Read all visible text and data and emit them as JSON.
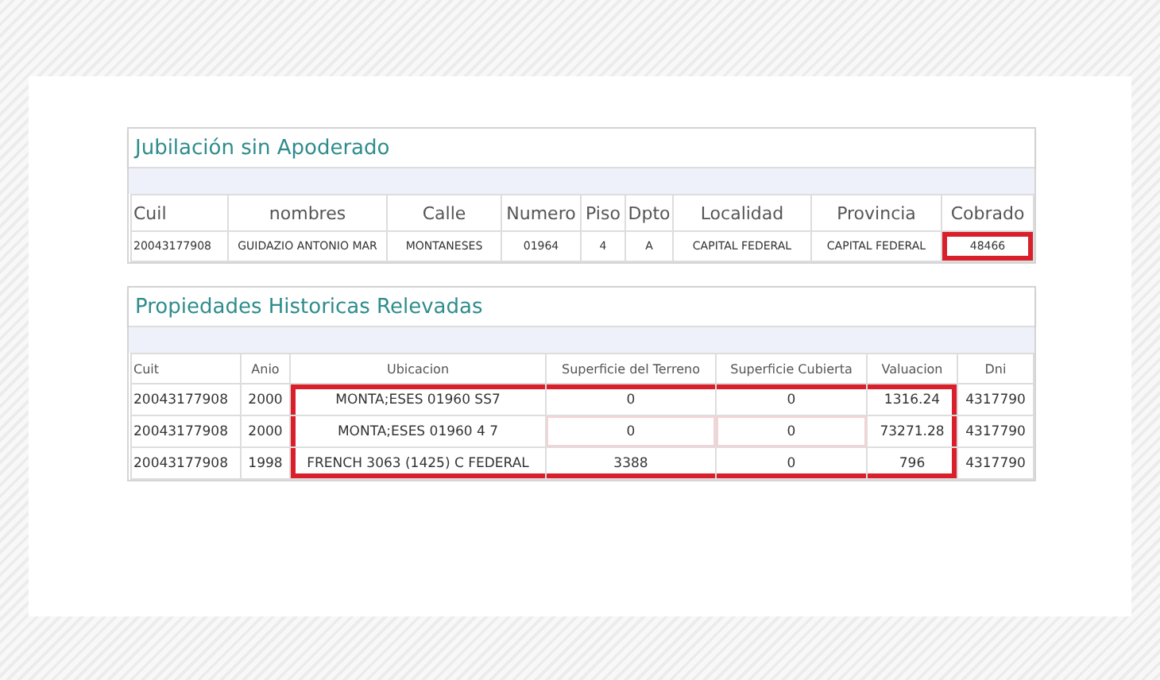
{
  "sections": [
    {
      "title": "Jubilación sin Apoderado",
      "columns": [
        "Cuil",
        "nombres",
        "Calle",
        "Numero",
        "Piso",
        "Dpto",
        "Localidad",
        "Provincia",
        "Cobrado"
      ],
      "rows": [
        {
          "cells": [
            {
              "text": "20043177908",
              "highlighted": false
            },
            {
              "text": "GUIDAZIO ANTONIO MAR",
              "highlighted": false
            },
            {
              "text": "MONTANESES",
              "highlighted": false
            },
            {
              "text": "01964",
              "highlighted": false
            },
            {
              "text": "4",
              "highlighted": false
            },
            {
              "text": "A",
              "highlighted": false
            },
            {
              "text": "CAPITAL FEDERAL",
              "highlighted": false
            },
            {
              "text": "CAPITAL FEDERAL",
              "highlighted": false
            },
            {
              "text": "48466",
              "highlighted": true
            }
          ]
        }
      ]
    },
    {
      "title": "Propiedades Historicas Relevadas",
      "columns": [
        "Cuit",
        "Anio",
        "Ubicacion",
        "Superficie del Terreno",
        "Superficie Cubierta",
        "Valuacion",
        "Dni"
      ],
      "rows": [
        {
          "cells": [
            {
              "text": "20043177908",
              "highlighted": false
            },
            {
              "text": "2000",
              "highlighted": false
            },
            {
              "text": "MONTA;ESES 01960 SS7",
              "highlighted": true
            },
            {
              "text": "0",
              "highlighted": true
            },
            {
              "text": "0",
              "highlighted": true
            },
            {
              "text": "1316.24",
              "highlighted": true
            },
            {
              "text": "4317790",
              "highlighted": false
            }
          ]
        },
        {
          "cells": [
            {
              "text": "20043177908",
              "highlighted": false
            },
            {
              "text": "2000",
              "highlighted": false
            },
            {
              "text": "MONTA;ESES 01960 4 7",
              "highlighted": true
            },
            {
              "text": "0",
              "highlighted": true
            },
            {
              "text": "0",
              "highlighted": true
            },
            {
              "text": "73271.28",
              "highlighted": true
            },
            {
              "text": "4317790",
              "highlighted": false
            }
          ]
        },
        {
          "cells": [
            {
              "text": "20043177908",
              "highlighted": false
            },
            {
              "text": "1998",
              "highlighted": false
            },
            {
              "text": "FRENCH 3063 (1425) C FEDERAL",
              "highlighted": true
            },
            {
              "text": "3388",
              "highlighted": true
            },
            {
              "text": "0",
              "highlighted": true
            },
            {
              "text": "796",
              "highlighted": true
            },
            {
              "text": "4317790",
              "highlighted": false
            }
          ]
        }
      ]
    }
  ]
}
